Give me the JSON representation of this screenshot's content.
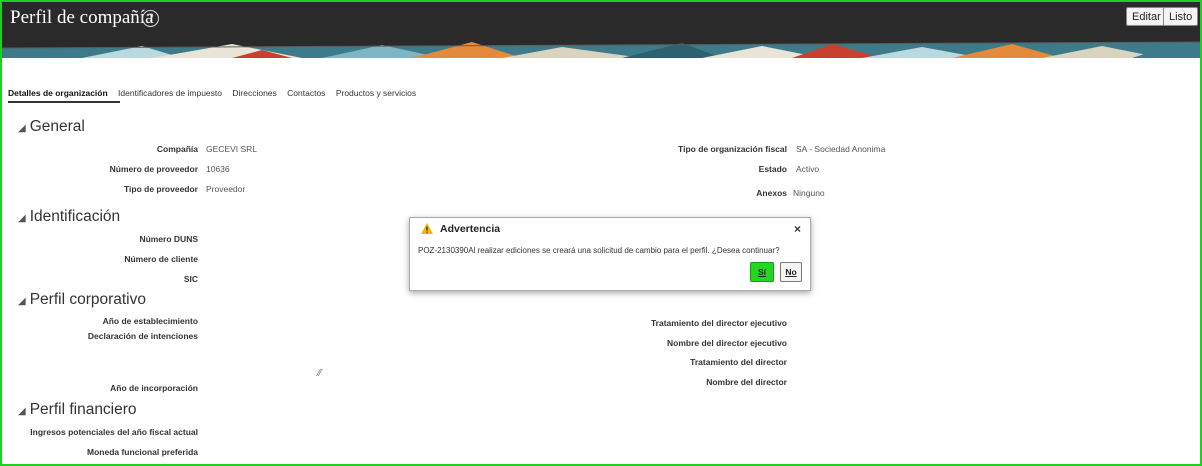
{
  "header": {
    "title": "Perfil de compañía",
    "help_icon": "?",
    "edit_label": "Editar",
    "done_label": "Listo"
  },
  "tabs": [
    {
      "label": "Detalles de organización",
      "active": true
    },
    {
      "label": "Identificadores de impuesto"
    },
    {
      "label": "Direcciones"
    },
    {
      "label": "Contactos"
    },
    {
      "label": "Productos y servicios"
    }
  ],
  "sections": {
    "general": {
      "title": "General",
      "company_label": "Compañía",
      "company_value": "GECEVI SRL",
      "supplier_number_label": "Número de proveedor",
      "supplier_number_value": "10636",
      "supplier_type_label": "Tipo de proveedor",
      "supplier_type_value": "Proveedor",
      "tax_org_type_label": "Tipo de organización fiscal",
      "tax_org_type_value": "SA - Sociedad Anonima",
      "status_label": "Estado",
      "status_value": "Activo",
      "attachments_label": "Anexos",
      "attachments_value": "Ninguno"
    },
    "identification": {
      "title": "Identificación",
      "duns_label": "Número DUNS",
      "customer_number_label": "Número de cliente",
      "sic_label": "SIC"
    },
    "corporate": {
      "title": "Perfil corporativo",
      "year_established_label": "Año de establecimiento",
      "mission_label": "Declaración de intenciones",
      "year_incorporated_label": "Año de incorporación",
      "ceo_title_label": "Tratamiento del director ejecutivo",
      "ceo_name_label": "Nombre del director ejecutivo",
      "principal_title_label": "Tratamiento del director",
      "principal_name_label": "Nombre del director"
    },
    "financial": {
      "title": "Perfil financiero",
      "potential_revenue_label": "Ingresos potenciales del año fiscal actual",
      "preferred_currency_label": "Moneda funcional preferida"
    }
  },
  "dialog": {
    "title": "Advertencia",
    "close": "×",
    "message": "POZ-2130390Al realizar ediciones se creará una solicitud de cambio para el perfil. ¿Desea continuar?",
    "yes_label": "Sí",
    "no_label": "No"
  },
  "colors": {
    "highlight": "#22d622",
    "header_bg": "#2a2a2a",
    "warning": "#f5b400"
  }
}
